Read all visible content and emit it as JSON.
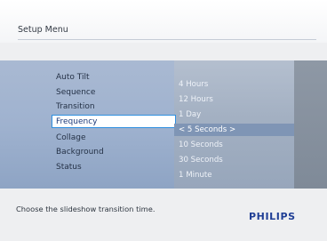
{
  "header": {
    "title": "Setup Menu"
  },
  "left_menu": {
    "items": [
      "Auto Tilt",
      "Sequence",
      "Transition",
      "Frequency",
      "Collage",
      "Background",
      "Status"
    ],
    "selected_index": 3
  },
  "options": {
    "items": [
      "4 Hours",
      "12 Hours",
      "1 Day",
      "< 5 Seconds >",
      "10 Seconds",
      "30 Seconds",
      "1 Minute"
    ],
    "selected_index": 3
  },
  "footer": {
    "help_text": "Choose the slideshow transition time.",
    "brand": "PHILIPS"
  },
  "colors": {
    "brand": "#1f3e95",
    "selection_border": "#2f8fe0",
    "selected_option_bg": "#7f95b5"
  }
}
